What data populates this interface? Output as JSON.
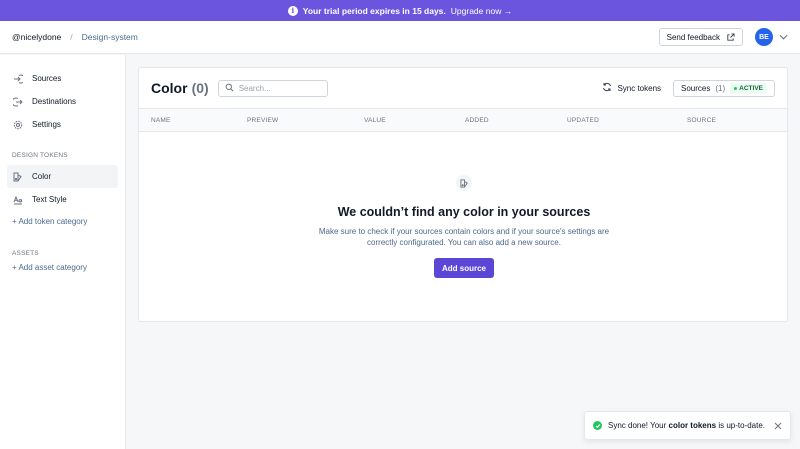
{
  "banner": {
    "bold_text": "Your trial period expires in 15 days.",
    "link_text": "Upgrade now →"
  },
  "topbar": {
    "org": "@nicelydone",
    "separator": "/",
    "project": "Design-system",
    "feedback_label": "Send feedback",
    "avatar_initials": "BE"
  },
  "sidebar": {
    "nav": [
      {
        "label": "Sources",
        "icon": "sources-icon"
      },
      {
        "label": "Destinations",
        "icon": "destinations-icon"
      },
      {
        "label": "Settings",
        "icon": "gear-icon"
      }
    ],
    "design_tokens_heading": "DESIGN TOKENS",
    "tokens": [
      {
        "label": "Color",
        "icon": "color-swatch-icon",
        "active": true
      },
      {
        "label": "Text Style",
        "icon": "text-style-icon",
        "active": false
      }
    ],
    "add_token_category": "+ Add token category",
    "assets_heading": "ASSETS",
    "add_asset_category": "+ Add asset category"
  },
  "panel": {
    "title": "Color",
    "count": "(0)",
    "search_placeholder": "Search...",
    "sync_label": "Sync tokens",
    "sources_label": "Sources",
    "sources_count": "(1)",
    "active_badge": "ACTIVE",
    "columns": [
      "NAME",
      "PREVIEW",
      "VALUE",
      "ADDED",
      "UPDATED",
      "SOURCE"
    ],
    "empty_title": "We couldn’t find any color in your sources",
    "empty_description": "Make sure to check if your sources contain colors and if your source’s settings are correctly configurated. You can also add a new source.",
    "add_source_label": "Add source"
  },
  "toast": {
    "prefix": "Sync done! Your",
    "bold": "color tokens",
    "suffix": "is up-to-date."
  },
  "colors": {
    "banner": "#6c55de",
    "primary_button": "#5b47d6",
    "avatar": "#2563eb",
    "success": "#22c55e"
  }
}
